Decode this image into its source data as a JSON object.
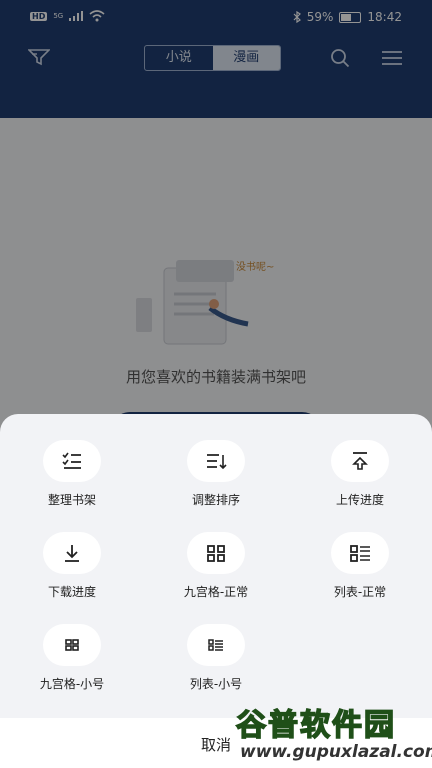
{
  "status_bar": {
    "hd": "HD",
    "net": "5G",
    "battery": "59%",
    "time": "18:42"
  },
  "header": {
    "tabs": [
      "小说",
      "漫画"
    ],
    "active_tab": 1
  },
  "empty": {
    "bubble": "没书呢~",
    "text": "用您喜欢的书籍装满书架吧"
  },
  "menu": {
    "items": [
      {
        "label": "整理书架",
        "icon": "sort-check-icon"
      },
      {
        "label": "调整排序",
        "icon": "sort-down-icon"
      },
      {
        "label": "上传进度",
        "icon": "upload-icon"
      },
      {
        "label": "下载进度",
        "icon": "download-icon"
      },
      {
        "label": "九宫格-正常",
        "icon": "grid-icon"
      },
      {
        "label": "列表-正常",
        "icon": "list-icon"
      },
      {
        "label": "九宫格-小号",
        "icon": "grid-small-icon"
      },
      {
        "label": "列表-小号",
        "icon": "list-small-icon"
      }
    ],
    "cancel": "取消"
  },
  "watermark": {
    "line1": "谷普软件园",
    "line2": "www.gupuxlazal.com"
  },
  "colors": {
    "header": "#1f3d70",
    "sheet": "#f2f3f6",
    "brand_green": "#7cc242"
  }
}
